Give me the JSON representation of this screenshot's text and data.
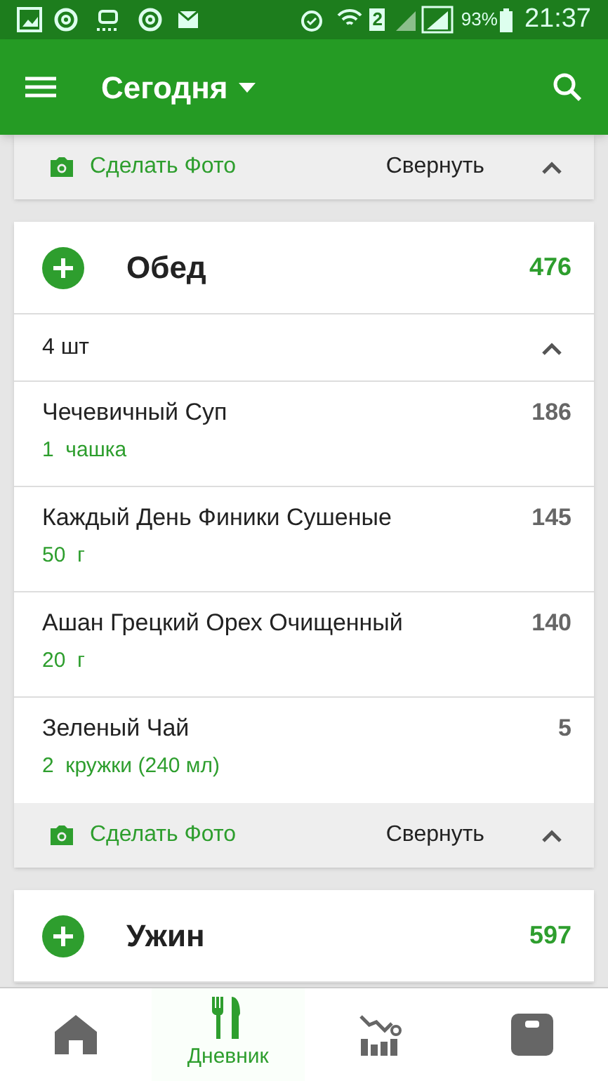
{
  "status_bar": {
    "sim": "2",
    "battery": "93%",
    "time": "21:37"
  },
  "app_bar": {
    "title": "Сегодня"
  },
  "top_footer": {
    "photo": "Сделать Фото",
    "collapse": "Свернуть"
  },
  "meals": [
    {
      "name": "Обед",
      "calories": "476",
      "count": "4 шт",
      "items": [
        {
          "name": "Чечевичный Суп",
          "amount": "1  чашка",
          "calories": "186"
        },
        {
          "name": "Каждый День Финики Сушеные",
          "amount": "50  г",
          "calories": "145"
        },
        {
          "name": "Ашан Грецкий Орех Очищенный",
          "amount": "20  г",
          "calories": "140"
        },
        {
          "name": "Зеленый Чай",
          "amount": "2  кружки (240 мл)",
          "calories": "5"
        }
      ],
      "footer": {
        "photo": "Сделать Фото",
        "collapse": "Свернуть"
      }
    },
    {
      "name": "Ужин",
      "calories": "597"
    }
  ],
  "bottom_nav": [
    {
      "kind": "home",
      "selected": false
    },
    {
      "kind": "diary",
      "label": "Дневник",
      "selected": true
    },
    {
      "kind": "chart",
      "selected": false
    },
    {
      "kind": "scale",
      "selected": false
    }
  ]
}
